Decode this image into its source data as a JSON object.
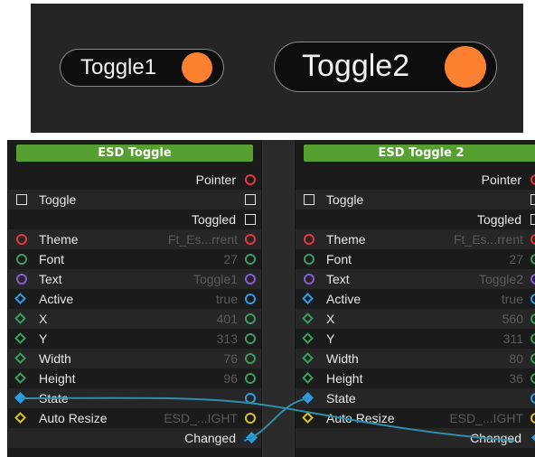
{
  "preview": {
    "toggle1": {
      "label": "Toggle1",
      "knob_color": "#fb8131"
    },
    "toggle2": {
      "label": "Toggle2",
      "knob_color": "#fb8131"
    }
  },
  "colors": {
    "header_green": "#55a030",
    "pin_red": "#e8363c",
    "pin_green": "#3c9a63",
    "pin_purple": "#8a5ad8",
    "pin_blue": "#2f9be0",
    "pin_yellow": "#d7c21f",
    "wire": "#2e8ea8"
  },
  "nodes": [
    {
      "id": "nodeA",
      "title": "ESD Toggle",
      "rows": [
        {
          "name": "",
          "value": "",
          "out_label": "Pointer",
          "left_pin": "",
          "right_pin": "circle-red"
        },
        {
          "name": "Toggle",
          "value": "",
          "out_label": "",
          "left_pin": "square",
          "right_pin": "square"
        },
        {
          "name": "",
          "value": "",
          "out_label": "Toggled",
          "left_pin": "",
          "right_pin": "square"
        },
        {
          "name": "Theme",
          "value": "Ft_Es...rrent",
          "out_label": "",
          "left_pin": "circle-red",
          "right_pin": "circle-red"
        },
        {
          "name": "Font",
          "value": "27",
          "out_label": "",
          "left_pin": "circle-green",
          "right_pin": "circle-green"
        },
        {
          "name": "Text",
          "value": "Toggle1",
          "out_label": "",
          "left_pin": "circle-purple",
          "right_pin": "circle-purple"
        },
        {
          "name": "Active",
          "value": "true",
          "out_label": "",
          "left_pin": "diamond-blue",
          "right_pin": "circle-blue"
        },
        {
          "name": "X",
          "value": "401",
          "out_label": "",
          "left_pin": "diamond-green",
          "right_pin": "circle-green"
        },
        {
          "name": "Y",
          "value": "313",
          "out_label": "",
          "left_pin": "diamond-green",
          "right_pin": "circle-green"
        },
        {
          "name": "Width",
          "value": "76",
          "out_label": "",
          "left_pin": "diamond-green",
          "right_pin": "circle-green"
        },
        {
          "name": "Height",
          "value": "96",
          "out_label": "",
          "left_pin": "diamond-green",
          "right_pin": "circle-green"
        },
        {
          "name": "State",
          "value": "",
          "out_label": "",
          "left_pin": "diamond-blue-filled",
          "right_pin": "circle-blue"
        },
        {
          "name": "Auto Resize",
          "value": "ESD_...IGHT",
          "out_label": "",
          "left_pin": "diamond-yellow",
          "right_pin": "circle-yellow"
        },
        {
          "name": "",
          "value": "",
          "out_label": "Changed",
          "left_pin": "",
          "right_pin": "diamond-blue-filled"
        }
      ]
    },
    {
      "id": "nodeB",
      "title": "ESD Toggle 2",
      "rows": [
        {
          "name": "",
          "value": "",
          "out_label": "Pointer",
          "left_pin": "",
          "right_pin": "circle-red"
        },
        {
          "name": "Toggle",
          "value": "",
          "out_label": "",
          "left_pin": "square",
          "right_pin": "square"
        },
        {
          "name": "",
          "value": "",
          "out_label": "Toggled",
          "left_pin": "",
          "right_pin": "square"
        },
        {
          "name": "Theme",
          "value": "Ft_Es...rrent",
          "out_label": "",
          "left_pin": "circle-red",
          "right_pin": "circle-red"
        },
        {
          "name": "Font",
          "value": "27",
          "out_label": "",
          "left_pin": "circle-green",
          "right_pin": "circle-green"
        },
        {
          "name": "Text",
          "value": "Toggle2",
          "out_label": "",
          "left_pin": "circle-purple",
          "right_pin": "circle-purple"
        },
        {
          "name": "Active",
          "value": "true",
          "out_label": "",
          "left_pin": "diamond-blue",
          "right_pin": "circle-blue"
        },
        {
          "name": "X",
          "value": "560",
          "out_label": "",
          "left_pin": "diamond-green",
          "right_pin": "circle-green"
        },
        {
          "name": "Y",
          "value": "311",
          "out_label": "",
          "left_pin": "diamond-green",
          "right_pin": "circle-green"
        },
        {
          "name": "Width",
          "value": "80",
          "out_label": "",
          "left_pin": "diamond-green",
          "right_pin": "circle-green"
        },
        {
          "name": "Height",
          "value": "36",
          "out_label": "",
          "left_pin": "diamond-green",
          "right_pin": "circle-green"
        },
        {
          "name": "State",
          "value": "",
          "out_label": "",
          "left_pin": "diamond-blue-filled",
          "right_pin": "circle-blue"
        },
        {
          "name": "Auto Resize",
          "value": "ESD_...IGHT",
          "out_label": "",
          "left_pin": "diamond-yellow",
          "right_pin": "circle-yellow"
        },
        {
          "name": "",
          "value": "",
          "out_label": "Changed",
          "left_pin": "",
          "right_pin": "diamond-blue-filled"
        }
      ]
    }
  ]
}
